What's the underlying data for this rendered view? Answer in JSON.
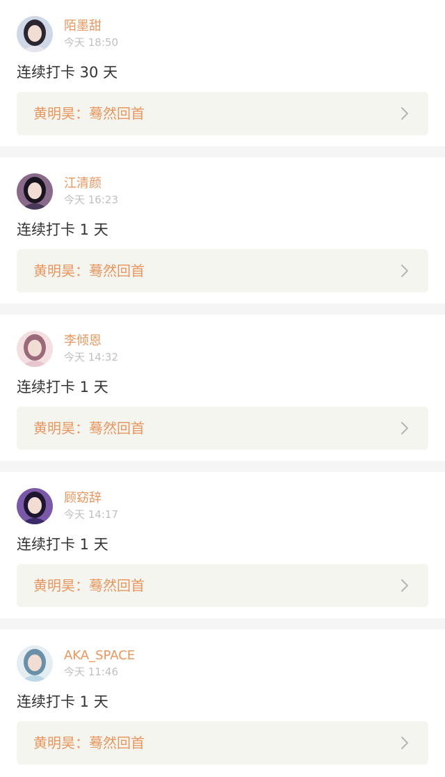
{
  "feed": {
    "items": [
      {
        "username": "陌墨甜",
        "time": "今天 18:50",
        "streak": "连续打卡 30 天",
        "quote": "黄明昊：蓦然回首",
        "avatar_colors": [
          "#e8e4ee",
          "#2b2630",
          "#cfd8e6"
        ]
      },
      {
        "username": "江清颜",
        "time": "今天 16:23",
        "streak": "连续打卡 1 天",
        "quote": "黄明昊：蓦然回首",
        "avatar_colors": [
          "#4a3a5a",
          "#1a1420",
          "#8a6a8a"
        ]
      },
      {
        "username": "李倾恩",
        "time": "今天 14:32",
        "streak": "连续打卡 1 天",
        "quote": "黄明昊：蓦然回首",
        "avatar_colors": [
          "#e6c6cf",
          "#9b6a7a",
          "#f3dfe2"
        ]
      },
      {
        "username": "顾窈辞",
        "time": "今天 14:17",
        "streak": "连续打卡 1 天",
        "quote": "黄明昊：蓦然回首",
        "avatar_colors": [
          "#3b2a6a",
          "#1e1530",
          "#7a5aa8"
        ]
      },
      {
        "username": "AKA_SPACE",
        "time": "今天 11:46",
        "streak": "连续打卡 1 天",
        "quote": "黄明昊：蓦然回首",
        "avatar_colors": [
          "#bcd7e6",
          "#6a8fa8",
          "#e4edf2"
        ]
      }
    ]
  },
  "colors": {
    "accent": "#e8965f",
    "quote_bg": "#f5f5ef",
    "timestamp": "#c0c0c0",
    "body_text": "#333333",
    "divider": "#f5f5f5"
  },
  "icons": {
    "chevron": "chevron-right-icon"
  }
}
